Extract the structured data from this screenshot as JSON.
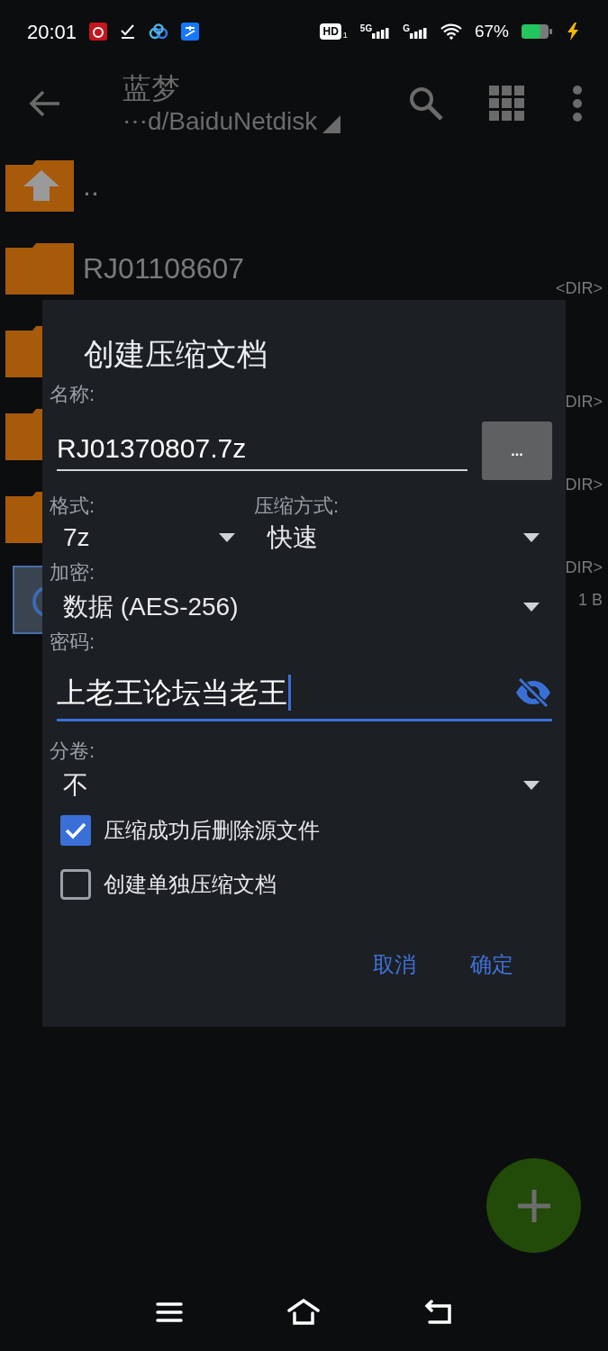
{
  "status_bar": {
    "time": "20:01",
    "hd": "HD",
    "hd_sim": "1",
    "sim1_net": "5G",
    "sim2_net": "G",
    "battery": "67%"
  },
  "toolbar": {
    "title": "蓝梦",
    "path": "⋯d/BaiduNetdisk"
  },
  "files": [
    {
      "kind": "parent",
      "name": ".."
    },
    {
      "kind": "folder",
      "name": "RJ01108607",
      "meta": "<DIR>"
    },
    {
      "kind": "folder",
      "meta": "DIR>"
    },
    {
      "kind": "folder",
      "meta": "DIR>"
    },
    {
      "kind": "folder",
      "meta": "DIR>"
    },
    {
      "kind": "image",
      "meta": "1 B"
    }
  ],
  "dialog": {
    "title": "创建压缩文档",
    "name_label": "名称:",
    "name_value": "RJ01370807.7z",
    "browse_button": "...",
    "format": {
      "label": "格式:",
      "value": "7z"
    },
    "method": {
      "label": "压缩方式:",
      "value": "快速"
    },
    "encryption": {
      "label": "加密:",
      "value": "数据 (AES-256)"
    },
    "password": {
      "label": "密码:",
      "value": "上老王论坛当老王"
    },
    "split": {
      "label": "分卷:",
      "value": "不"
    },
    "options": [
      {
        "label": "压缩成功后删除源文件",
        "checked": true
      },
      {
        "label": "创建单独压缩文档",
        "checked": false
      }
    ],
    "buttons": [
      "取消",
      "确定"
    ]
  }
}
